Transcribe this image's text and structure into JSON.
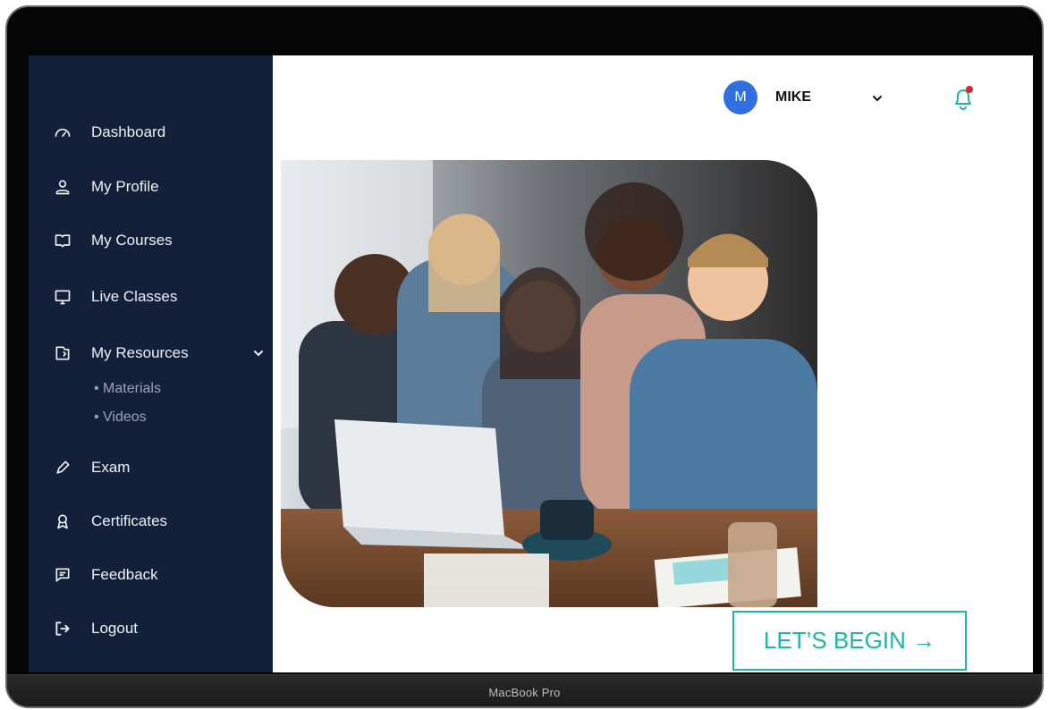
{
  "device": {
    "label": "MacBook Pro"
  },
  "sidebar": {
    "items": [
      {
        "label": "Dashboard",
        "icon": "dashboard-gauge-icon"
      },
      {
        "label": "My Profile",
        "icon": "user-icon"
      },
      {
        "label": "My Courses",
        "icon": "book-open-icon"
      },
      {
        "label": "Live Classes",
        "icon": "monitor-icon"
      },
      {
        "label": "My Resources",
        "icon": "folder-share-icon",
        "expanded": true,
        "children": [
          {
            "label": "• Materials"
          },
          {
            "label": "• Videos"
          }
        ]
      },
      {
        "label": "Exam",
        "icon": "pencil-icon"
      },
      {
        "label": "Certificates",
        "icon": "award-icon"
      },
      {
        "label": "Feedback",
        "icon": "message-square-icon"
      },
      {
        "label": "Logout",
        "icon": "logout-icon"
      }
    ],
    "background": "#13203a"
  },
  "header": {
    "user": {
      "initial": "M",
      "name": "MIKE"
    },
    "notification": {
      "has_unread": true
    }
  },
  "hero": {
    "image": "group of smiling students with laptop"
  },
  "cta": {
    "label": "LET’S BEGIN →",
    "color": "#1fb6a8"
  }
}
